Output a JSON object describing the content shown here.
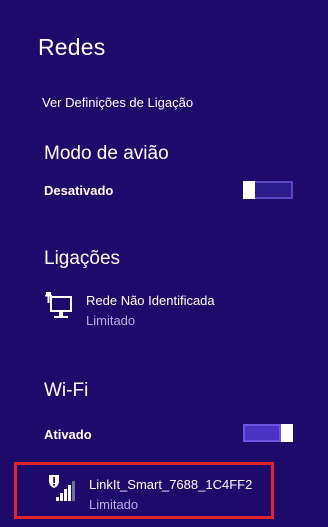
{
  "panel": {
    "title": "Redes",
    "settings_link": "Ver Definições de Ligação"
  },
  "airplane": {
    "heading": "Modo de avião",
    "state_label": "Desativado",
    "state_on": false
  },
  "connections": {
    "heading": "Ligações",
    "items": [
      {
        "name": "Rede Não Identificada",
        "status": "Limitado",
        "icon": "wired-network-icon"
      }
    ]
  },
  "wifi": {
    "heading": "Wi-Fi",
    "state_label": "Ativado",
    "state_on": true,
    "networks": [
      {
        "name": "LinkIt_Smart_7688_1C4FF2",
        "status": "Limitado",
        "icon": "wifi-secured-warning-icon",
        "signal_bars_filled": 4,
        "signal_bars_total": 5
      }
    ]
  },
  "colors": {
    "background": "#1e0a6b",
    "text": "#ffffff",
    "status_text": "#b6aee6",
    "toggle_on": "#4a33c4",
    "highlight_border": "#e3242b"
  }
}
